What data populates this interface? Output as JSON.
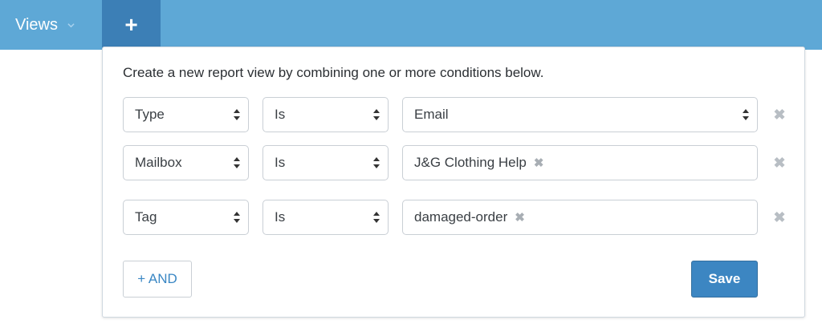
{
  "topbar": {
    "views_label": "Views",
    "add_label": "+"
  },
  "panel": {
    "intro": "Create a new report view by combining one or more conditions below.",
    "conditions": [
      {
        "field": "Type",
        "operator": "Is",
        "value": "Email",
        "value_kind": "select"
      },
      {
        "field": "Mailbox",
        "operator": "Is",
        "value": "J&G Clothing Help",
        "value_kind": "token"
      },
      {
        "field": "Tag",
        "operator": "Is",
        "value": "damaged-order",
        "value_kind": "token"
      }
    ],
    "remove_glyph": "✖",
    "token_remove_glyph": "✖",
    "and_label": "+ AND",
    "save_label": "Save"
  },
  "colors": {
    "topbar": "#5ea8d6",
    "active_tab": "#3c7fb6",
    "save_button": "#3c86c2",
    "link_blue": "#3a87c4"
  }
}
